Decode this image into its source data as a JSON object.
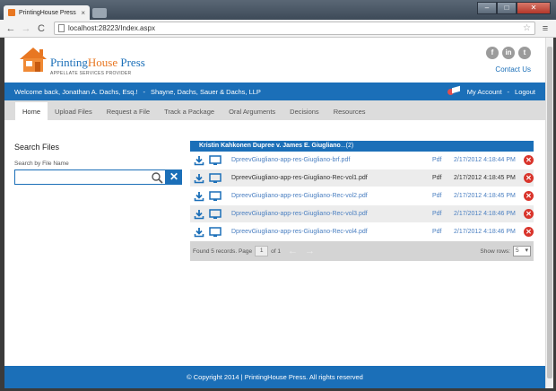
{
  "browser": {
    "tab_title": "PrintingHouse Press",
    "url": "localhost:28223/Index.aspx",
    "tab_close": "×",
    "back": "←",
    "forward": "→",
    "reload": "C",
    "star": "☆",
    "menu": "≡",
    "win_min": "‒",
    "win_max": "□",
    "win_close": "✕"
  },
  "brand": {
    "name_main": "Printing",
    "name_accent": "House",
    "name_rest": " Press",
    "tagline": "APPELLATE SERVICES PROVIDER",
    "colors": {
      "blue": "#1b6fb8",
      "orange": "#e87722"
    }
  },
  "social": {
    "facebook": "f",
    "linkedin": "in",
    "twitter": "t",
    "contact": "Contact Us"
  },
  "userbar": {
    "welcome": "Welcome back, Jonathan A. Dachs, Esq.!",
    "sep": "-",
    "firm": "Shayne, Dachs, Sauer & Dachs, LLP",
    "my_account": "My Account",
    "logout": "Logout"
  },
  "nav": {
    "tabs": [
      {
        "label": "Home"
      },
      {
        "label": "Upload Files"
      },
      {
        "label": "Request a File"
      },
      {
        "label": "Track a Package"
      },
      {
        "label": "Oral Arguments"
      },
      {
        "label": "Decisions"
      },
      {
        "label": "Resources"
      }
    ]
  },
  "search": {
    "title": "Search Files",
    "label": "Search by File Name",
    "value": "",
    "clear": "✕"
  },
  "case": {
    "title": "Kristin Kahkonen Dupree v. James E. Giugliano",
    "count": "...(2)",
    "files": [
      {
        "name": "DpreevGiugliano-app-res-Giugliano-brf.pdf",
        "type": "Pdf",
        "date": "2/17/2012 4:18:44 PM"
      },
      {
        "name": "DpreevGiugliano-app-res-Giugliano-Rec-vol1.pdf",
        "type": "Pdf",
        "date": "2/17/2012 4:18:45 PM"
      },
      {
        "name": "DpreevGiugliano-app-res-Giugliano-Rec-vol2.pdf",
        "type": "Pdf",
        "date": "2/17/2012 4:18:45 PM"
      },
      {
        "name": "DpreevGiugliano-app-res-Giugliano-Rec-vol3.pdf",
        "type": "Pdf",
        "date": "2/17/2012 4:18:46 PM"
      },
      {
        "name": "DpreevGiugliano-app-res-Giugliano-Rec-vol4.pdf",
        "type": "Pdf",
        "date": "2/17/2012 4:18:46 PM"
      }
    ],
    "delete_glyph": "✕"
  },
  "pager": {
    "found": "Found 5 records. Page",
    "page": "1",
    "of": "of 1",
    "prev": "←",
    "next": "→",
    "rows_label": "Show rows:",
    "rows_value": "5"
  },
  "footer": {
    "text": "© Copyright 2014 | PrintingHouse Press. All rights reserved"
  }
}
